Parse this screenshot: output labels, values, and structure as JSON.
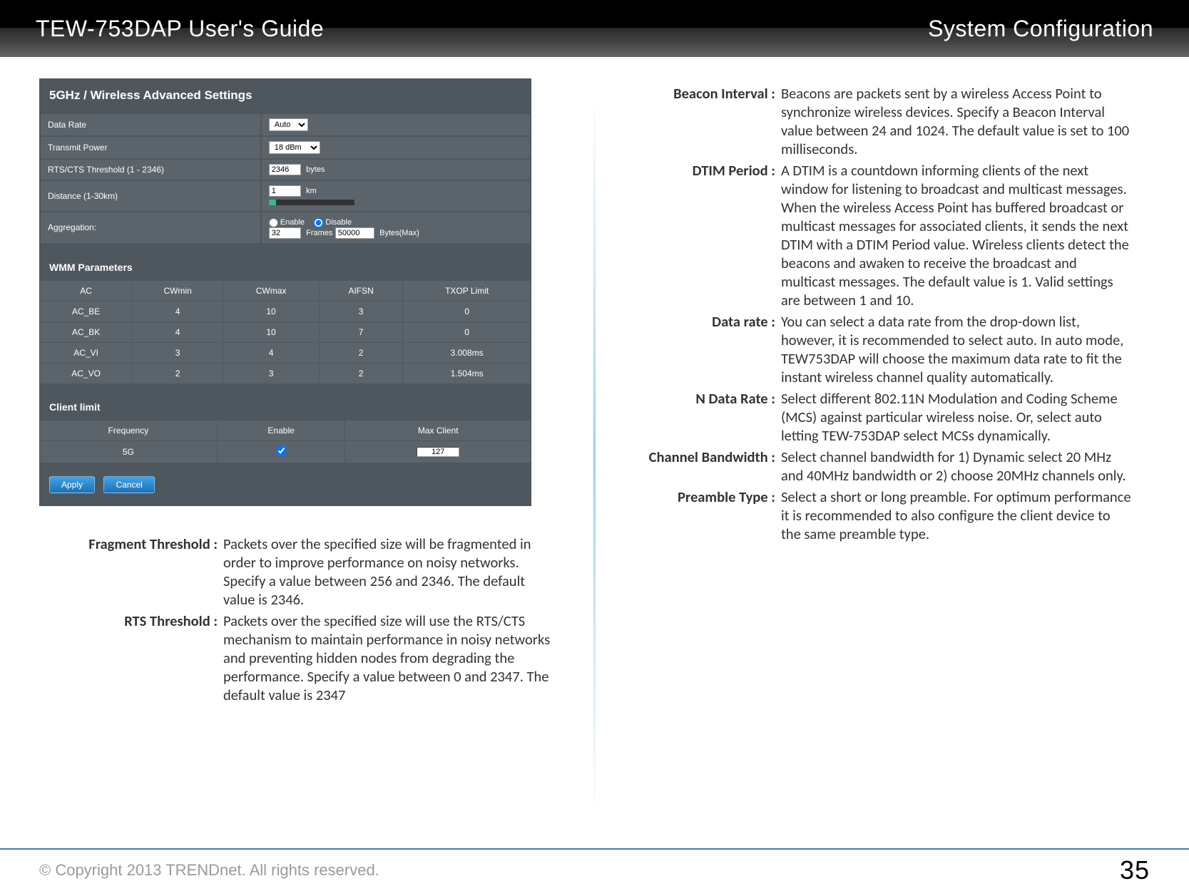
{
  "header": {
    "left": "TEW-753DAP User's Guide",
    "right": "System Configuration"
  },
  "panel": {
    "heading": "5GHz / Wireless Advanced Settings",
    "rows": {
      "data_rate": {
        "label": "Data Rate",
        "value": "Auto"
      },
      "tx_power": {
        "label": "Transmit Power",
        "value": "18 dBm"
      },
      "rts": {
        "label": "RTS/CTS Threshold (1 - 2346)",
        "value": "2346",
        "unit": "bytes"
      },
      "distance": {
        "label": "Distance (1-30km)",
        "value": "1",
        "unit": "km"
      },
      "aggregation": {
        "label": "Aggregation:",
        "enable_lbl": "Enable",
        "disable_lbl": "Disable",
        "frames": "32",
        "frames_unit": "Frames",
        "bytes": "50000",
        "bytes_unit": "Bytes(Max)"
      }
    },
    "wmm": {
      "heading": "WMM Parameters",
      "cols": [
        "AC",
        "CWmin",
        "CWmax",
        "AIFSN",
        "TXOP Limit"
      ],
      "rows": [
        [
          "AC_BE",
          "4",
          "10",
          "3",
          "0"
        ],
        [
          "AC_BK",
          "4",
          "10",
          "7",
          "0"
        ],
        [
          "AC_VI",
          "3",
          "4",
          "2",
          "3.008ms"
        ],
        [
          "AC_VO",
          "2",
          "3",
          "2",
          "1.504ms"
        ]
      ]
    },
    "client": {
      "heading": "Client limit",
      "cols": [
        "Frequency",
        "Enable",
        "Max Client"
      ],
      "freq": "5G",
      "max": "127"
    },
    "apply": "Apply",
    "cancel": "Cancel"
  },
  "defs_left": [
    {
      "term": "Fragment Threshold",
      "desc": "Packets over the specified size will be fragmented in order to improve performance on noisy networks. Specify a value between 256 and 2346. The default value is 2346."
    },
    {
      "term": "RTS Threshold",
      "desc": "Packets over the specified size will use the RTS/CTS mechanism to maintain performance in noisy networks and preventing hidden nodes from degrading the performance. Specify a value between 0 and 2347. The default value is 2347"
    }
  ],
  "defs_right": [
    {
      "term": "Beacon Interval",
      "desc": "Beacons are packets sent by a wireless Access Point to synchronize wireless devices. Specify a Beacon Interval value between 24 and 1024. The default value is set to 100 milliseconds."
    },
    {
      "term": "DTIM Period",
      "desc": "A DTIM is a countdown informing clients of the next window for listening to broadcast and multicast messages. When the wireless Access Point has buffered broadcast or multicast messages for associated clients, it sends the next DTIM with a DTIM Period value. Wireless clients detect the beacons and awaken to receive the broadcast and multicast messages. The default value is 1. Valid settings are between 1 and 10."
    },
    {
      "term": "Data rate",
      "desc": "You can select a data rate from the drop-down list, however, it is recommended to select auto. In auto mode, TEW753DAP will choose the maximum data rate to fit the instant wireless channel quality automatically."
    },
    {
      "term": "N Data Rate",
      "desc": "Select different 802.11N Modulation and Coding Scheme (MCS) against particular wireless noise. Or,  select auto letting TEW-753DAP select MCSs dynamically."
    },
    {
      "term": "Channel Bandwidth",
      "desc": "Select channel bandwidth for 1) Dynamic select 20 MHz and 40MHz bandwidth or 2) choose 20MHz channels only."
    },
    {
      "term": "Preamble Type",
      "desc": "Select a short or long preamble. For optimum performance it is recommended to also configure the client device to the same preamble type."
    }
  ],
  "footer": {
    "copyright": "© Copyright 2013 TRENDnet. All rights reserved.",
    "page": "35"
  }
}
